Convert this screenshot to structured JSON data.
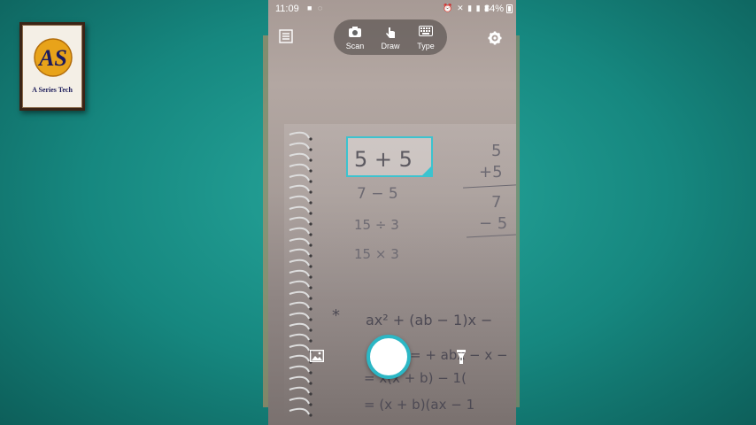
{
  "channel": {
    "logo_text": "A Series Tech",
    "logo_letters": "AS"
  },
  "status_bar": {
    "time": "11:09",
    "battery": "84%"
  },
  "modes": [
    {
      "label": "Scan",
      "icon": "camera-icon"
    },
    {
      "label": "Draw",
      "icon": "hand-draw-icon"
    },
    {
      "label": "Type",
      "icon": "keyboard-icon"
    }
  ],
  "toolbar": {
    "history_icon": "history-list-icon",
    "settings_icon": "gear-icon"
  },
  "camera_view": {
    "selected_equation": "5 + 5",
    "equations": [
      "7 − 5",
      "15 ÷ 3",
      "15 × 3"
    ],
    "right_column": [
      "5",
      "+5",
      "7",
      "− 5"
    ],
    "bottom_lines": [
      "ax² + (ab − 1)x −",
      "= + abx − x −",
      "= x(x + b) − 1(",
      "= (x + b)(ax − 1"
    ],
    "bullet": "*"
  },
  "bottom_controls": {
    "gallery_icon": "gallery-icon",
    "shutter_icon": "shutter-button",
    "flash_icon": "flashlight-icon"
  },
  "colors": {
    "accent": "#2cb7c5",
    "background": "#16877f"
  }
}
